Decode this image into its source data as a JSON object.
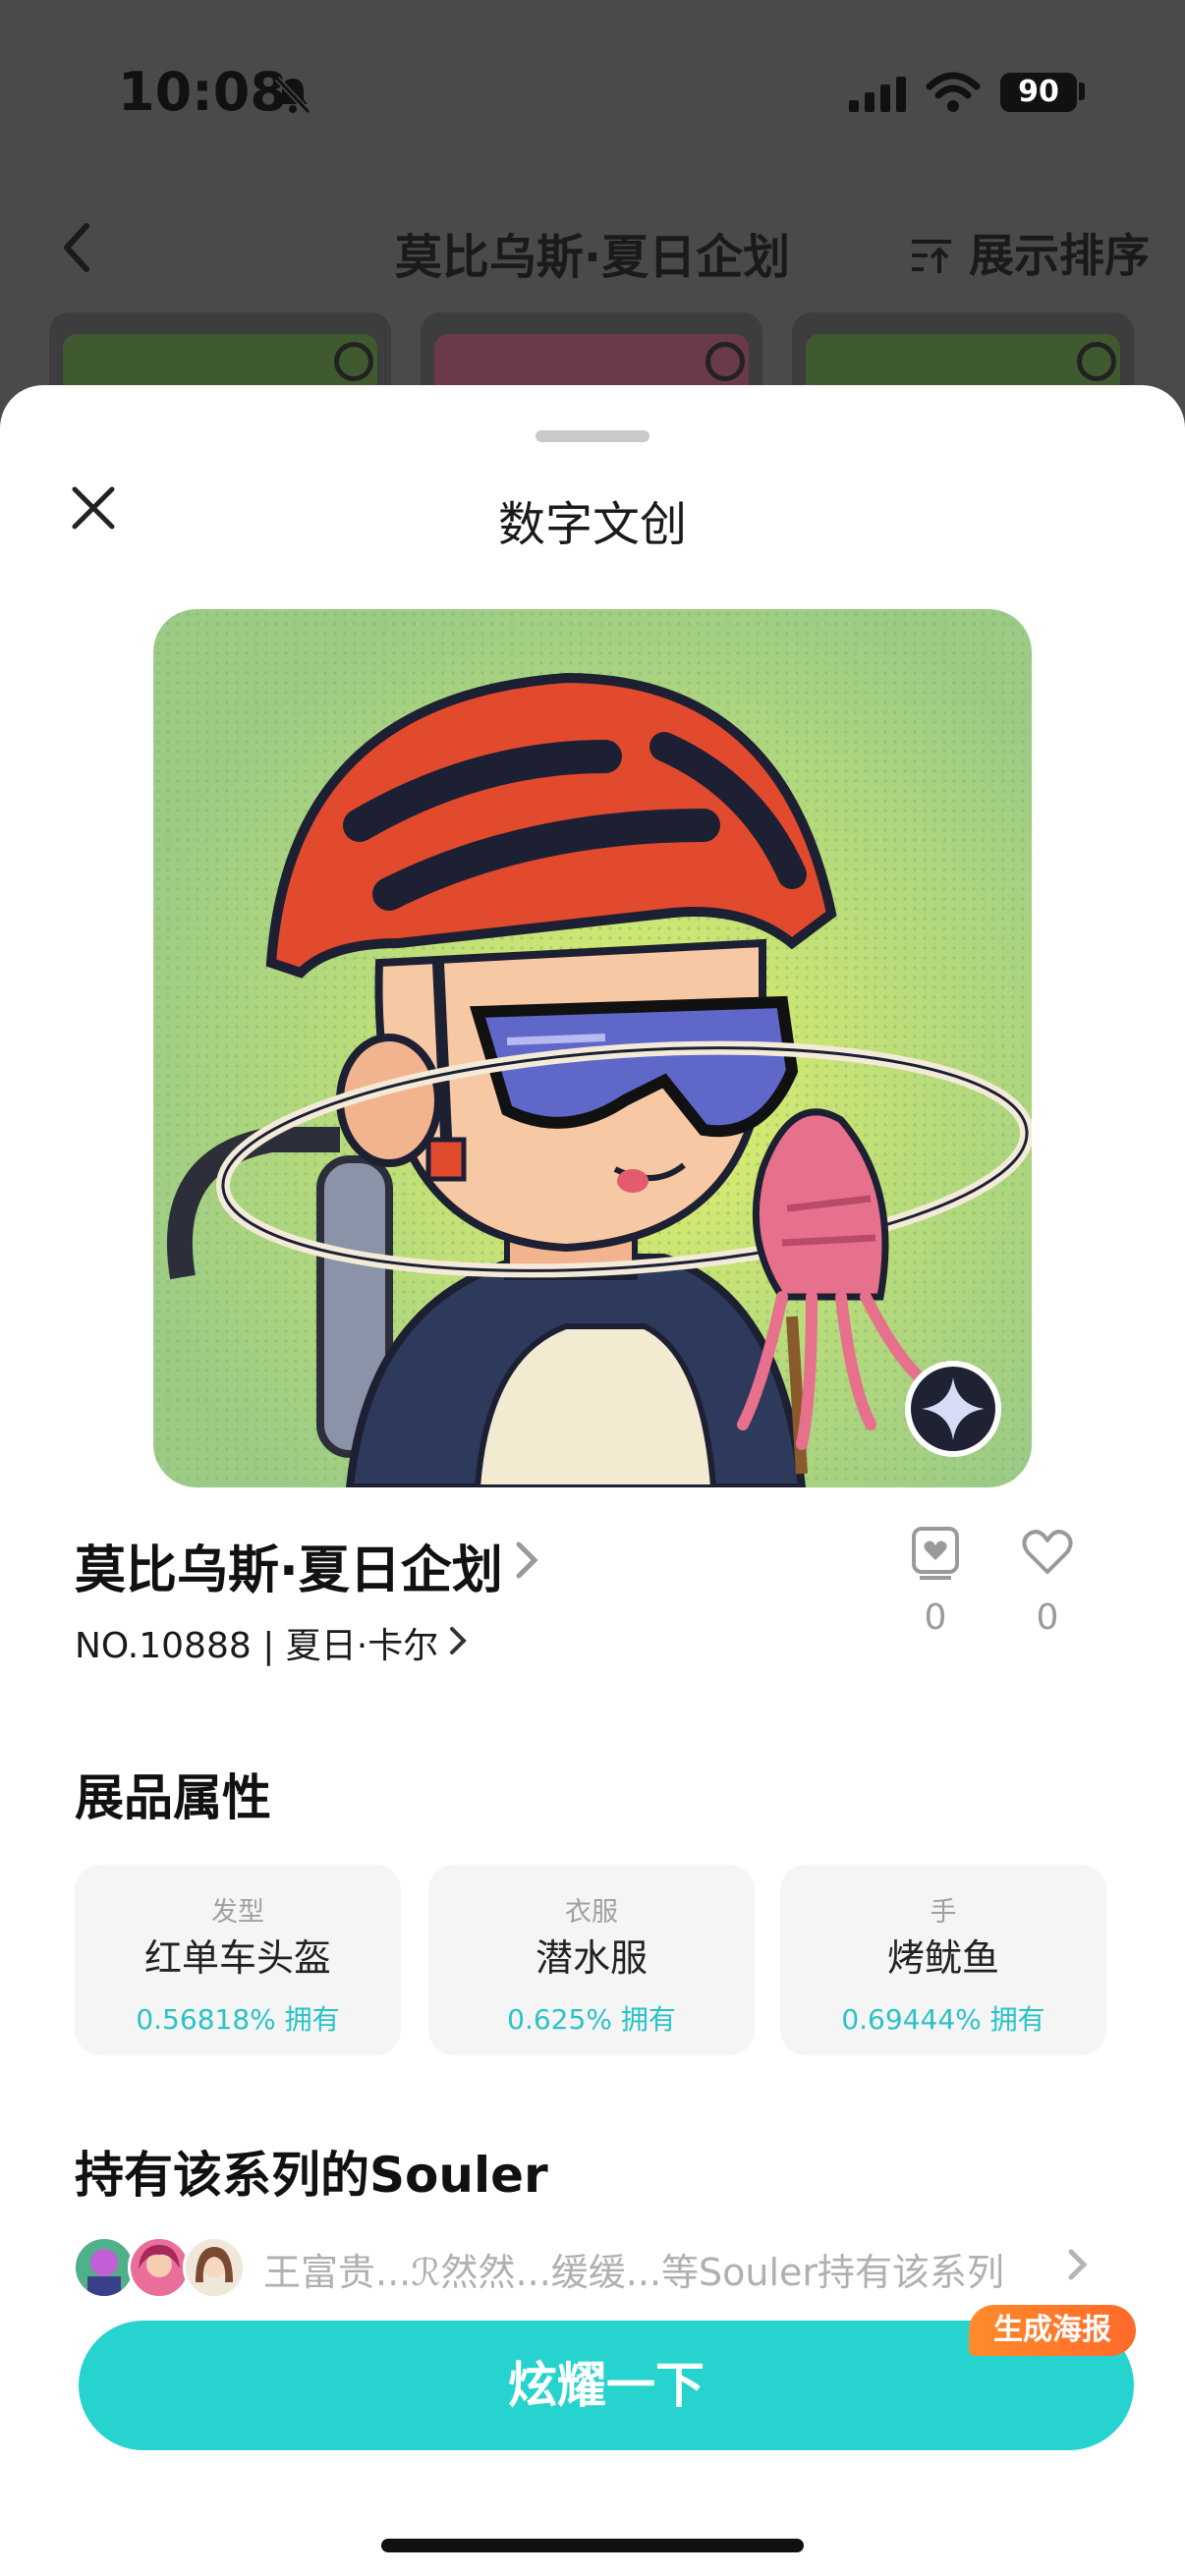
{
  "status_bar": {
    "time": "10:08",
    "battery": "90"
  },
  "header": {
    "title": "莫比乌斯·夏日企划",
    "sort_label": "展示排序"
  },
  "sheet": {
    "title": "数字文创",
    "item": {
      "name": "莫比乌斯·夏日企划",
      "subtitle": "NO.10888 | 夏日·卡尔",
      "stats": [
        {
          "icon": "collection-icon",
          "value": "0"
        },
        {
          "icon": "heart-icon",
          "value": "0"
        }
      ]
    },
    "attributes_title": "展品属性",
    "attributes": [
      {
        "category": "发型",
        "value": "红单车头盔",
        "percent": "0.56818% 拥有"
      },
      {
        "category": "衣服",
        "value": "潜水服",
        "percent": "0.625% 拥有"
      },
      {
        "category": "手",
        "value": "烤鱿鱼",
        "percent": "0.69444% 拥有"
      }
    ],
    "holders_title": "持有该系列的Souler",
    "holders_text": "王富贵...ℛ然然...缓缓...等Souler持有该系列",
    "cta_label": "炫耀一下",
    "poster_badge": "生成海报"
  },
  "colors": {
    "accent": "#27d3cf",
    "percent_text": "#29c3c6",
    "badge": "#ff7a2b",
    "art_bg": "#9ccb86"
  }
}
